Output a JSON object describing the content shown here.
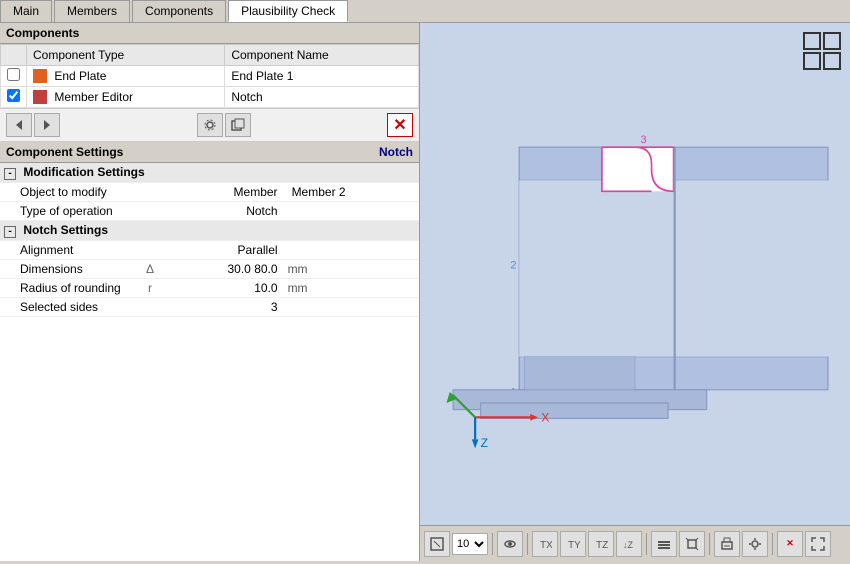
{
  "tabs": [
    {
      "label": "Main",
      "active": false
    },
    {
      "label": "Members",
      "active": false
    },
    {
      "label": "Components",
      "active": false
    },
    {
      "label": "Plausibility Check",
      "active": true
    }
  ],
  "components": {
    "section_label": "Components",
    "table": {
      "col1": "Component Type",
      "col2": "Component Name",
      "rows": [
        {
          "checked": false,
          "color": "#e06020",
          "type": "End Plate",
          "name": "End Plate 1"
        },
        {
          "checked": true,
          "color": "#c04040",
          "type": "Member Editor",
          "name": "Notch"
        }
      ]
    }
  },
  "toolbar_icons": [
    "arrow-left",
    "arrow-right",
    "gear",
    "save",
    "delete"
  ],
  "component_settings": {
    "section_label": "Component Settings",
    "notch_label": "Notch",
    "groups": [
      {
        "label": "Modification Settings",
        "rows": [
          {
            "label": "Object to modify",
            "sym": "",
            "value": "Member",
            "value2": "Member 2",
            "unit": ""
          },
          {
            "label": "Type of operation",
            "sym": "",
            "value": "Notch",
            "value2": "",
            "unit": ""
          }
        ]
      },
      {
        "label": "Notch Settings",
        "rows": [
          {
            "label": "Alignment",
            "sym": "",
            "value": "Parallel",
            "value2": "",
            "unit": ""
          },
          {
            "label": "Dimensions",
            "sym": "Δ",
            "value": "30.0",
            "value2": "80.0",
            "unit": "mm"
          },
          {
            "label": "Radius of rounding",
            "sym": "r",
            "value": "10.0",
            "value2": "",
            "unit": "mm"
          },
          {
            "label": "Selected sides",
            "sym": "",
            "value": "3",
            "value2": "",
            "unit": ""
          }
        ]
      }
    ]
  },
  "view_toolbar": {
    "zoom_value": "10",
    "buttons": [
      "fit",
      "zoom",
      "front",
      "x-axis",
      "y-axis",
      "z-axis",
      "neg-x",
      "neg-y",
      "neg-z",
      "render",
      "box",
      "print",
      "settings",
      "close",
      "expand"
    ]
  },
  "axes": {
    "x_label": "X",
    "z_label": "Z"
  }
}
